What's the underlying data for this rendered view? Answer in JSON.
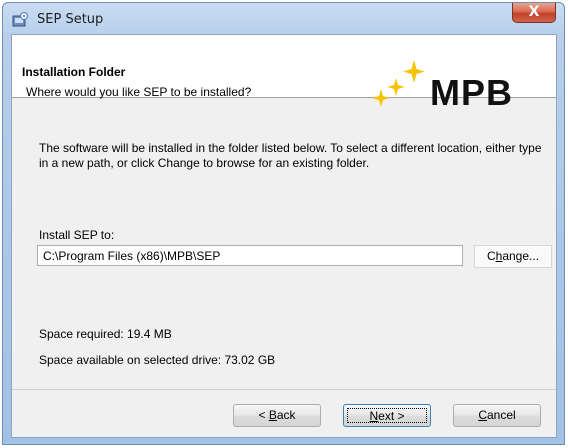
{
  "window": {
    "title": "SEP Setup",
    "close_symbol": "X"
  },
  "banner": {
    "title": "Installation Folder",
    "subtitle": "Where would you like SEP to be installed?",
    "logo_text": "MPB",
    "logo_accent_color": "#f5c400"
  },
  "body": {
    "description": "The software will be installed in the folder listed below. To select a different location, either type in a new path, or click Change to browse for an existing folder.",
    "install_label": "Install SEP to:",
    "install_path": "C:\\Program Files (x86)\\MPB\\SEP",
    "change_label_pre": "C",
    "change_label_u": "h",
    "change_label_post": "ange...",
    "space_required": "Space required: 19.4 MB",
    "space_available": "Space available on selected drive: 73.02 GB"
  },
  "buttons": {
    "back_pre": "< ",
    "back_u": "B",
    "back_post": "ack",
    "next_u": "N",
    "next_post": "ext >",
    "cancel_u": "C",
    "cancel_post": "ancel"
  }
}
